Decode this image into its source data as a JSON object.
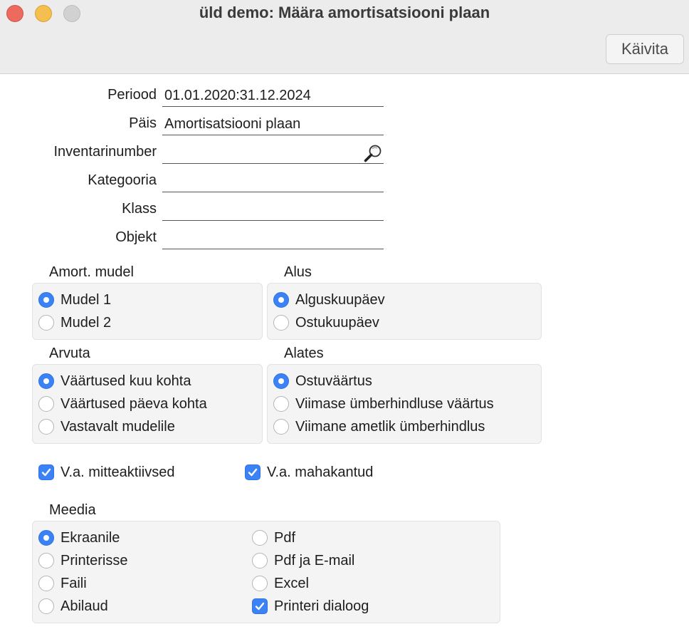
{
  "window": {
    "title": "üld demo: Määra amortisatsiooni plaan",
    "run_button": "Käivita"
  },
  "fields": {
    "period": {
      "label": "Periood",
      "value": "01.01.2020:31.12.2024"
    },
    "header": {
      "label": "Päis",
      "value": "Amortisatsiooni plaan"
    },
    "inventory": {
      "label": "Inventarinumber",
      "value": ""
    },
    "category": {
      "label": "Kategooria",
      "value": ""
    },
    "class": {
      "label": "Klass",
      "value": ""
    },
    "object": {
      "label": "Objekt",
      "value": ""
    }
  },
  "groups": {
    "model": {
      "label": "Amort. mudel",
      "options": [
        "Mudel 1",
        "Mudel 2"
      ],
      "selected": "Mudel 1"
    },
    "base": {
      "label": "Alus",
      "options": [
        "Alguskuupäev",
        "Ostukuupäev"
      ],
      "selected": "Alguskuupäev"
    },
    "calculate": {
      "label": "Arvuta",
      "options": [
        "Väärtused kuu kohta",
        "Väärtused päeva kohta",
        "Vastavalt mudelile"
      ],
      "selected": "Väärtused kuu kohta"
    },
    "from": {
      "label": "Alates",
      "options": [
        "Ostuväärtus",
        "Viimase ümberhindluse väärtus",
        "Viimane ametlik ümberhindlus"
      ],
      "selected": "Ostuväärtus"
    }
  },
  "checkboxes": {
    "exclude_inactive": {
      "label": "V.a. mitteaktiivsed",
      "checked": true
    },
    "exclude_written_off": {
      "label": "V.a. mahakantud",
      "checked": true
    }
  },
  "media": {
    "label": "Meedia",
    "options": [
      "Ekraanile",
      "Printerisse",
      "Faili",
      "Abilaud",
      "Pdf",
      "Pdf ja E-mail",
      "Excel"
    ],
    "selected": "Ekraanile",
    "printer_dialog": {
      "label": "Printeri dialoog",
      "checked": true
    }
  },
  "colors": {
    "accent": "#3b82f6",
    "titlebar": "#ececec",
    "group_bg": "#f4f4f4"
  }
}
